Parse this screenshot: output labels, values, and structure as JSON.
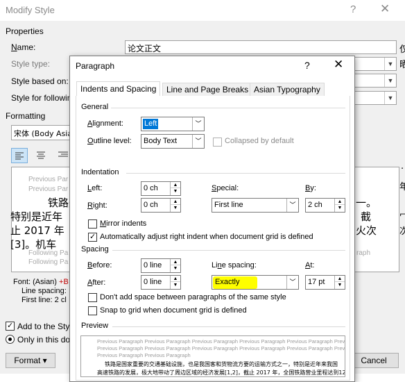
{
  "modify_style": {
    "title": "Modify Style",
    "properties_header": "Properties",
    "name_label": "Name:",
    "name_value": "论文正文",
    "style_type_label": "Style type:",
    "based_on_label": "Style based on:",
    "following_label": "Style for followin",
    "formatting_header": "Formatting",
    "font_value": "宋体 (Body Asian",
    "preview_prev_1": "Previous Par",
    "preview_prev_2": "Previous Par",
    "preview_line1": "铁路是",
    "preview_line1_end": "一。",
    "preview_line2": "特别是近年",
    "preview_line2_end": "截",
    "preview_line3": "止 2017 年",
    "preview_line3_end": "火次",
    "preview_line4": "[3]。机车",
    "preview_follow_1": "Following Pa",
    "preview_follow_2": "Following Pa",
    "preview_follow_right": "raph",
    "desc_line1_a": "Font: (Asian) ",
    "desc_line1_b": "+B",
    "desc_line2": "Line spacing:",
    "desc_line3": "First line:  2 cl",
    "add_to_styles": "Add to the Styl",
    "only_this_doc": "Only in this do",
    "format_button": "Format ▾",
    "cancel_button": "Cancel",
    "right_cut_1": "仅",
    "right_cut_2": "晒",
    "right_cut_3": "·",
    "right_cut_4": "年",
    "right_cut_5": "冖",
    "right_cut_6": "次"
  },
  "paragraph": {
    "title": "Paragraph",
    "help": "?",
    "close": "✕",
    "tabs": [
      {
        "label": "Indents and Spacing",
        "selected": true
      },
      {
        "label": "Line and Page Breaks",
        "selected": false
      },
      {
        "label": "Asian Typography",
        "selected": false
      }
    ],
    "general": {
      "header": "General",
      "alignment_label": "Alignment:",
      "alignment_value": "Left",
      "outline_label": "Outline level:",
      "outline_value": "Body Text",
      "collapsed_label": "Collapsed by default"
    },
    "indentation": {
      "header": "Indentation",
      "left_label": "Left:",
      "left_value": "0 ch",
      "right_label": "Right:",
      "right_value": "0 ch",
      "special_label": "Special:",
      "special_value": "First line",
      "by_label": "By:",
      "by_value": "2 ch",
      "mirror_label": "Mirror indents",
      "auto_adjust_label": "Automatically adjust right indent when document grid is defined"
    },
    "spacing": {
      "header": "Spacing",
      "before_label": "Before:",
      "before_value": "0 line",
      "after_label": "After:",
      "after_value": "0 line",
      "line_spacing_label": "Line spacing:",
      "line_spacing_value": "Exactly",
      "at_label": "At:",
      "at_value": "17 pt",
      "dont_add_label": "Don't add space between paragraphs of the same style",
      "snap_label": "Snap to grid when document grid is defined"
    },
    "preview": {
      "header": "Preview",
      "prev_line_1": "Previous Paragraph Previous Paragraph Previous Paragraph Previous Paragraph Previous Paragraph Previous Paragraph",
      "prev_line_2": "Previous Paragraph Previous Paragraph Previous Paragraph Previous Paragraph Previous Paragraph Previous Paragraph",
      "prev_line_3": "Previous Paragraph Previous Paragraph",
      "sample_1": "铁路是国家重要的交通基础设施，也是我国客和货物流方要的运输方式之一，特别是近年来我国",
      "sample_2": "高速铁路的发展，极大地带动了周边区域的经济发展[1,2]，截止 2017 年，全国铁路营业里程达到12.7"
    },
    "colors": {
      "selection_bg": "#0078d7",
      "highlight": "#ffff00"
    }
  }
}
